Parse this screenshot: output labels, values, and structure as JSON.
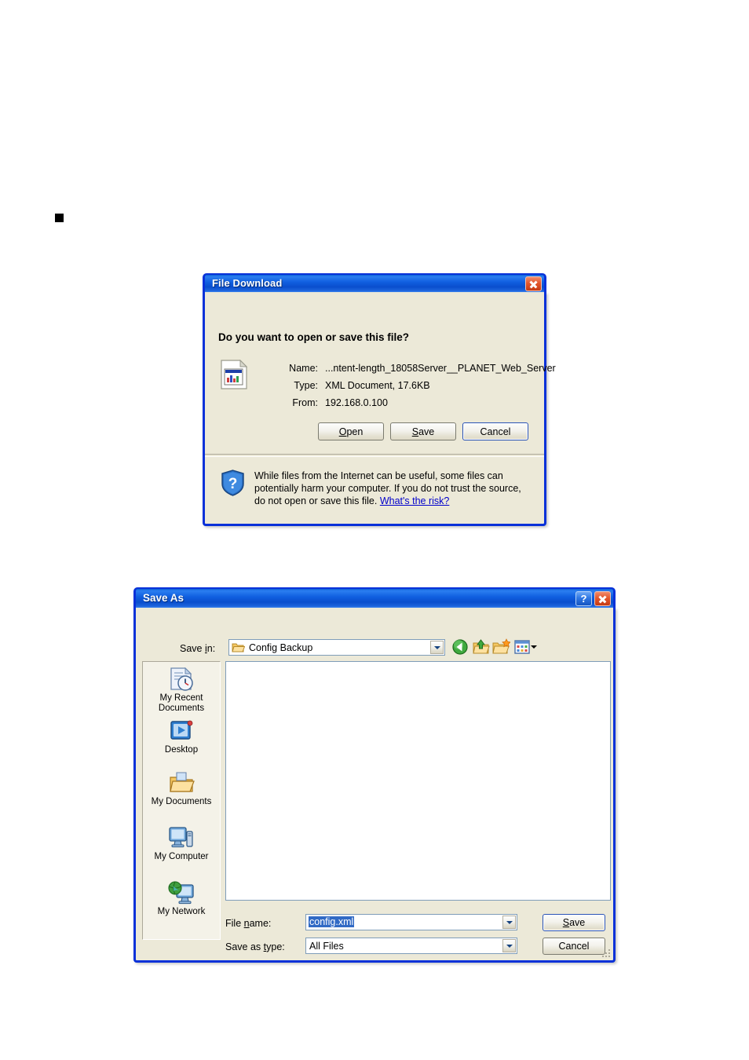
{
  "page": {
    "bullet": "■"
  },
  "file_download": {
    "title": "File Download",
    "close_icon": "close-icon",
    "heading": "Do you want to open or save this file?",
    "file_icon": "xml-document-icon",
    "fields": [
      {
        "label": "Name:",
        "value": "...ntent-length_18058Server__PLANET_Web_Server"
      },
      {
        "label": "Type:",
        "value": "XML Document, 17.6KB"
      },
      {
        "label": "From:",
        "value": "192.168.0.100"
      }
    ],
    "buttons": {
      "open": {
        "pre": "",
        "accel": "O",
        "post": "pen"
      },
      "save": {
        "pre": "",
        "accel": "S",
        "post": "ave"
      },
      "cancel": {
        "label": "Cancel"
      }
    },
    "warning": {
      "shield_icon": "shield-question-icon",
      "text": "While files from the Internet can be useful, some files can potentially harm your computer. If you do not trust the source, do not open or save this file. ",
      "link": "What's the risk?"
    }
  },
  "save_as": {
    "title": "Save As",
    "help_icon": "?",
    "close_icon": "close-icon",
    "save_in": {
      "label_pre": "Save ",
      "label_accel": "i",
      "label_post": "n:",
      "value": "Config Backup",
      "folder_icon": "open-folder-icon"
    },
    "toolbar": [
      {
        "name": "back-button",
        "icon": "back-arrow-icon"
      },
      {
        "name": "up-one-level-button",
        "icon": "up-folder-icon"
      },
      {
        "name": "new-folder-button",
        "icon": "new-folder-icon"
      },
      {
        "name": "views-button",
        "icon": "views-grid-icon"
      }
    ],
    "places": [
      {
        "icon": "my-recent-documents-icon",
        "label": "My Recent\nDocuments"
      },
      {
        "icon": "desktop-icon",
        "label": "Desktop"
      },
      {
        "icon": "my-documents-icon",
        "label": "My Documents"
      },
      {
        "icon": "my-computer-icon",
        "label": "My Computer"
      },
      {
        "icon": "my-network-icon",
        "label": "My Network"
      }
    ],
    "file_list_items": [],
    "file_name": {
      "label_pre": "File ",
      "label_accel": "n",
      "label_post": "ame:",
      "value": "config.xml",
      "selected": true
    },
    "save_as_type": {
      "label_pre": "Save as ",
      "label_accel": "t",
      "label_post": "ype:",
      "value": "All Files"
    },
    "buttons": {
      "save": {
        "pre": "",
        "accel": "S",
        "post": "ave"
      },
      "cancel": {
        "label": "Cancel"
      }
    }
  },
  "colors": {
    "title_blue": "#0831d9",
    "dialog_face": "#ece9d8",
    "selection_blue": "#316ac5",
    "link_blue": "#0000cc",
    "close_red": "#c43a14"
  }
}
